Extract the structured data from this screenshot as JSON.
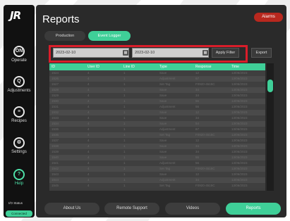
{
  "app": {
    "logo": "JR"
  },
  "header": {
    "title": "Reports",
    "alarms_label": "Alarms"
  },
  "sidebar": {
    "items": [
      {
        "key": "operate",
        "label": "Operate",
        "icon_glyph": "ON"
      },
      {
        "key": "adjustments",
        "label": "Adjustments",
        "icon_glyph": "Q"
      },
      {
        "key": "recipes",
        "label": "Recipes",
        "icon_glyph": "≡"
      },
      {
        "key": "settings",
        "label": "Settings",
        "icon_glyph": "⚙"
      },
      {
        "key": "help",
        "label": "Help",
        "icon_glyph": "?"
      }
    ],
    "io_status_label": "I/O Status",
    "io_status_value": "Connected"
  },
  "tabs": [
    {
      "label": "Production"
    },
    {
      "label": "Event Logger"
    }
  ],
  "filter": {
    "start_date": "2023-02-10",
    "end_date": "2023-02-10",
    "apply_label": "Apply Filter",
    "export_label": "Export"
  },
  "table": {
    "columns": [
      "ID",
      "User ID",
      "Line ID",
      "Type",
      "Response",
      "Time"
    ],
    "rows": [
      [
        "1524",
        "4",
        "1",
        "Save",
        "12",
        "13/06/2023"
      ],
      [
        "1526",
        "4",
        "1",
        "Adjustment",
        "67",
        "13/06/2023"
      ],
      [
        "1527",
        "4",
        "1",
        "Set Tag",
        "F0920-4515C",
        "13/06/2023"
      ],
      [
        "1528",
        "4",
        "1",
        "Save",
        "34",
        "13/06/2023"
      ],
      [
        "1529",
        "4",
        "1",
        "Save",
        "34",
        "13/06/2023"
      ],
      [
        "1530",
        "4",
        "1",
        "Save",
        "56",
        "13/06/2023"
      ],
      [
        "1531",
        "4",
        "1",
        "Adjustment",
        "56",
        "13/06/2023"
      ],
      [
        "1532",
        "4",
        "1",
        "Save",
        "12",
        "13/06/2023"
      ],
      [
        "1533",
        "4",
        "1",
        "Save",
        "34",
        "13/06/2023"
      ],
      [
        "1534",
        "4",
        "1",
        "Save",
        "54",
        "13/06/2023"
      ],
      [
        "1535",
        "4",
        "1",
        "Adjustment",
        "67",
        "13/06/2023"
      ],
      [
        "1536",
        "4",
        "1",
        "Set Tag",
        "F0920-4515C",
        "13/06/2023"
      ],
      [
        "1537",
        "4",
        "1",
        "Save",
        "12",
        "13/06/2023"
      ],
      [
        "1538",
        "4",
        "1",
        "Save",
        "34",
        "13/06/2023"
      ],
      [
        "1539",
        "4",
        "1",
        "Save",
        "34",
        "13/06/2023"
      ],
      [
        "1540",
        "4",
        "1",
        "Save",
        "56",
        "13/06/2023"
      ],
      [
        "1541",
        "4",
        "1",
        "Adjustment",
        "56",
        "13/06/2023"
      ],
      [
        "1542",
        "4",
        "1",
        "Set Tag",
        "F0920-4515C",
        "13/06/2023"
      ],
      [
        "1543",
        "4",
        "1",
        "Save",
        "12",
        "13/06/2023"
      ],
      [
        "1544",
        "4",
        "1",
        "Adjustment",
        "34",
        "13/06/2023"
      ],
      [
        "1545",
        "4",
        "1",
        "Set Tag",
        "F0920-4515C",
        "13/06/2023"
      ]
    ]
  },
  "footer": {
    "buttons": [
      {
        "label": "About Us"
      },
      {
        "label": "Remote Support"
      },
      {
        "label": "Videos"
      },
      {
        "label": "Reports"
      }
    ]
  },
  "colors": {
    "accent": "#3fcf98",
    "alarm": "#b8281e",
    "highlight_border": "#d91d2a",
    "panel": "#2a2a2a",
    "sidebar": "#111111"
  }
}
